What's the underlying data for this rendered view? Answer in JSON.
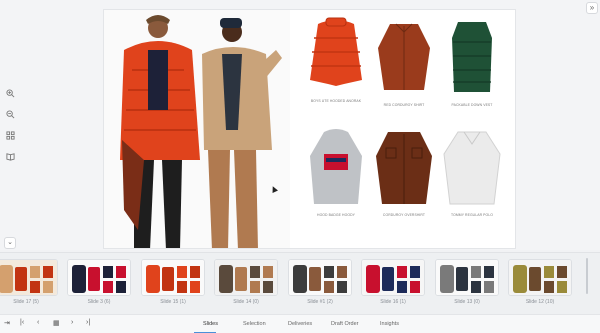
{
  "toolbar": {
    "zoom_in_icon": "zoom-in-icon",
    "zoom_out_icon": "zoom-out-icon",
    "grid_icon": "grid-icon",
    "book_icon": "book-icon"
  },
  "slide": {
    "products": [
      {
        "caption": "BOYS UTE HOODED ANORAK",
        "color": "#e0431c"
      },
      {
        "caption": "RED CORDUROY SHIRT",
        "color": "#9a3b1c"
      },
      {
        "caption": "PACKABLE DOWN VEST",
        "color": "#1f5136"
      },
      {
        "caption": "HOOD BADGE HOODY",
        "color": "#bfc2c6"
      },
      {
        "caption": "CORDUROY OVERSHIRT",
        "color": "#6b2e16"
      },
      {
        "caption": "TOMMY REGULAR POLO",
        "color": "#ebebeb"
      }
    ]
  },
  "filmstrip": {
    "slides": [
      {
        "label": "Slide 17 (5)"
      },
      {
        "label": "Slide 3 (6)"
      },
      {
        "label": "Slide 15 (1)"
      },
      {
        "label": "Slide 14 (0)"
      },
      {
        "label": "Slide #1 (2)"
      },
      {
        "label": "Slide 16 (1)"
      },
      {
        "label": "Slide 13 (0)"
      },
      {
        "label": "Slide 12 (10)"
      }
    ]
  },
  "bottom": {
    "tabs": [
      "Slides",
      "Selection",
      "Deliveries",
      "Draft Order",
      "Insights"
    ],
    "active_tab": "Slides"
  },
  "colors": {
    "accent": "#4a90d9"
  }
}
